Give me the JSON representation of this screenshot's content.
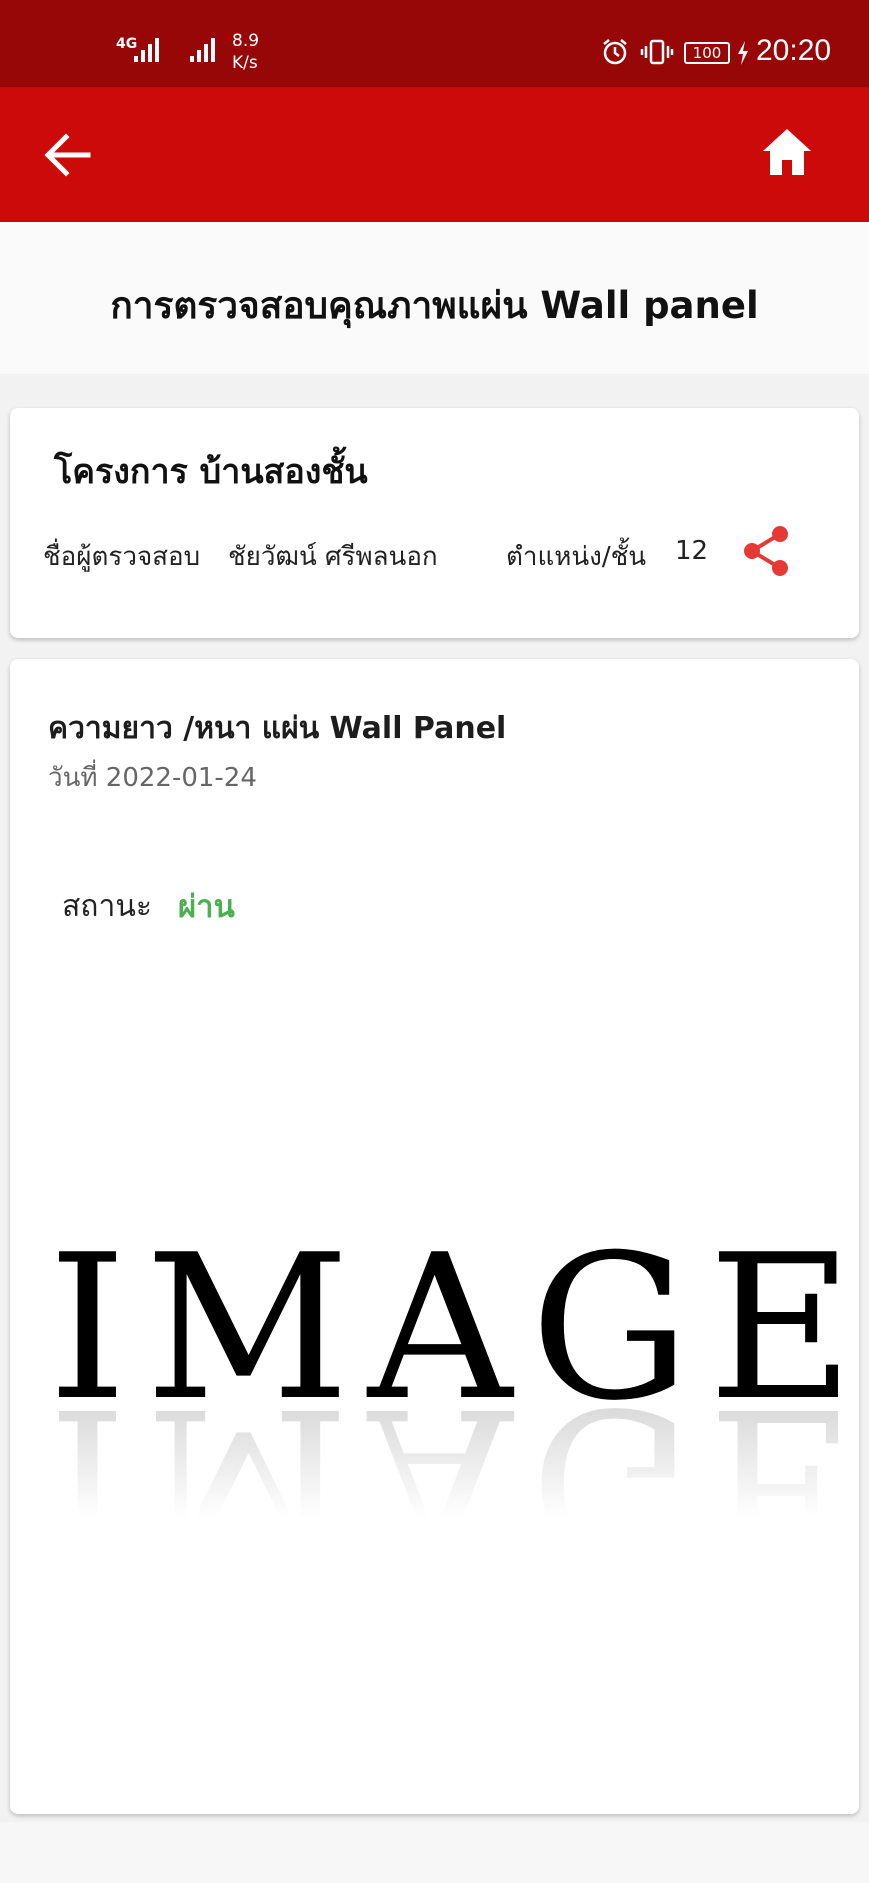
{
  "status_bar": {
    "network": "4G",
    "speed_value": "8.9",
    "speed_unit": "K/s",
    "battery": "100",
    "time": "20:20"
  },
  "app_bar": {
    "back_icon": "arrow-back-icon",
    "home_icon": "home-icon",
    "color": "#cc0a0a"
  },
  "page": {
    "title": "การตรวจสอบคุณภาพแผ่น Wall panel"
  },
  "info": {
    "project": "โครงการ บ้านสองชั้น",
    "inspector_label": "ชื่อผู้ตรวจสอบ",
    "inspector_name": "ชัยวัฒน์ ศรีพลนอก",
    "position_label": "ตำแหน่ง/ชั้น",
    "position_value": "12",
    "share_icon": "share-icon"
  },
  "detail": {
    "item_title": "ความยาว /หนา แผ่น Wall Panel",
    "date": "วันที่ 2022-01-24",
    "status_label": "สถานะ",
    "status_value": "ผ่าน",
    "status_color": "#4caf50",
    "image_text": "IMAGE"
  }
}
